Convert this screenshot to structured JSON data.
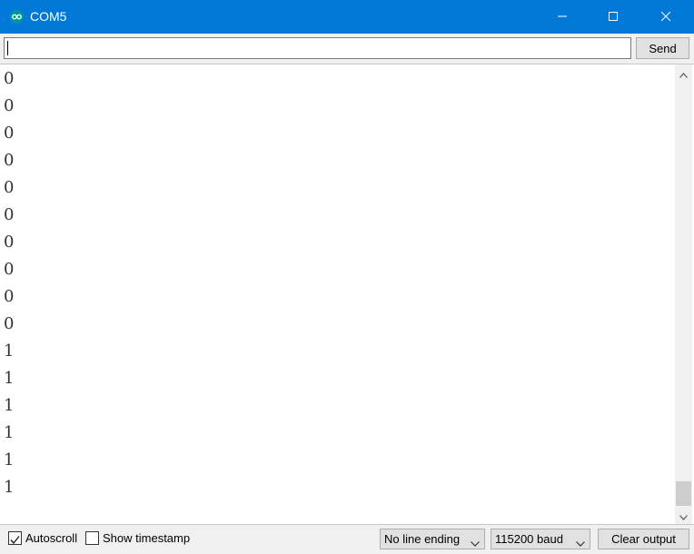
{
  "window": {
    "title": "COM5",
    "icon": "arduino-infinity-icon",
    "controls": [
      "minimize-icon",
      "maximize-icon",
      "close-icon"
    ]
  },
  "input": {
    "value": "",
    "send_label": "Send"
  },
  "output": {
    "lines": [
      "0",
      "0",
      "0",
      "0",
      "0",
      "0",
      "0",
      "0",
      "0",
      "0",
      "1",
      "1",
      "1",
      "1",
      "1",
      "1"
    ]
  },
  "footer": {
    "autoscroll_label": "Autoscroll",
    "autoscroll_checked": true,
    "timestamp_label": "Show timestamp",
    "timestamp_checked": false,
    "line_ending": "No line ending",
    "baud_rate": "115200 baud",
    "clear_label": "Clear output"
  },
  "colors": {
    "titlebar": "#0078d7",
    "app_icon": "#00979c"
  }
}
